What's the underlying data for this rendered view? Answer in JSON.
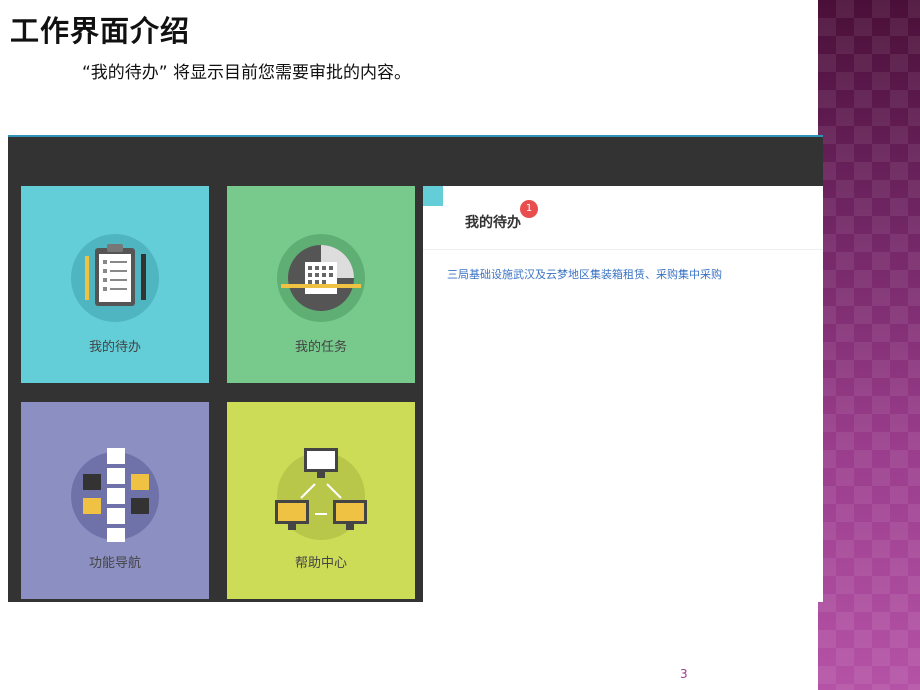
{
  "slide": {
    "title": "工作界面介绍",
    "subtitle": "“我的待办”  将显示目前您需要审批的内容。",
    "page_number": "3"
  },
  "app": {
    "tiles": [
      {
        "label": "我的待办",
        "icon": "clipboard-icon",
        "color": "#63cdd8"
      },
      {
        "label": "我的任务",
        "icon": "calendar-icon",
        "color": "#77c98c"
      },
      {
        "label": "功能导航",
        "icon": "sitemap-icon",
        "color": "#8c8fc2"
      },
      {
        "label": "帮助中心",
        "icon": "network-computers-icon",
        "color": "#cddc57"
      }
    ],
    "todo_panel": {
      "title": "我的待办",
      "badge_count": "1",
      "items": [
        "三局基础设施武汉及云梦地区集装箱租赁、采购集中采购"
      ]
    }
  }
}
